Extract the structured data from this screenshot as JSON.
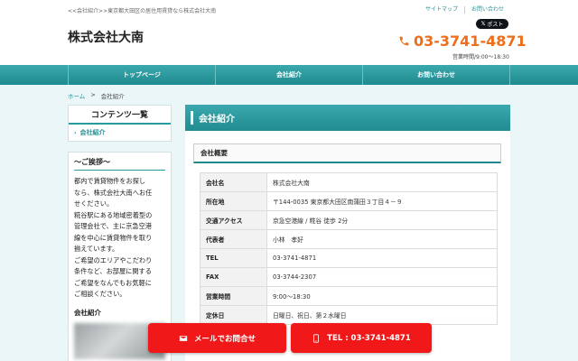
{
  "header": {
    "tagline": "<<会社紹介>>東京都大田区の居住用賃貸なら株式会社大南",
    "links": [
      "サイトマップ",
      "お問い合わせ"
    ],
    "x_post_label": "ポスト",
    "site_title": "株式会社大南",
    "phone": "03-3741-4871",
    "hours": "営業時間/9:00～18:30",
    "accent_color": "#ee6e1a"
  },
  "nav": {
    "items": [
      "トップページ",
      "会社紹介",
      "お問い合わせ"
    ]
  },
  "breadcrumb": {
    "home": "ホーム",
    "separator": ">",
    "current": "会社紹介"
  },
  "sidebar": {
    "contents_title": "コンテンツ一覧",
    "contents_item": "会社紹介",
    "greeting_title": "～ご挨拶～",
    "greeting_lines": [
      "都内で賃貸物件をお探し",
      "なら、株式会社大南へお任",
      "せください。",
      "糀谷駅にある地域密着型の",
      "管理会社で、主に京急空港",
      "線を中心に賃貸物件を取り",
      "揃えています。",
      "ご希望のエリアやこだわり",
      "条件など、お部屋に関する",
      "ご希望をなんでもお気軽に",
      "ご相談ください。"
    ],
    "company_label": "会社紹介"
  },
  "main": {
    "page_heading": "会社紹介",
    "section_heading": "会社概要",
    "rows": [
      {
        "key": "会社名",
        "value": "株式会社大南"
      },
      {
        "key": "所在地",
        "value": "〒144-0035 東京都大田区南蒲田３丁目４－９"
      },
      {
        "key": "交通アクセス",
        "value": "京急空港線 / 糀谷 徒歩 2分"
      },
      {
        "key": "代表者",
        "value": "小林　孝好"
      },
      {
        "key": "TEL",
        "value": "03-3741-4871"
      },
      {
        "key": "FAX",
        "value": "03-3744-2307"
      },
      {
        "key": "営業時間",
        "value": "9:00～18:30"
      },
      {
        "key": "定休日",
        "value": "日曜日、祝日、第２水曜日"
      }
    ]
  },
  "cta": {
    "mail_label": "メールでお問合せ",
    "tel_label": "TEL : 03-3741-4871",
    "color": "#f01818"
  }
}
